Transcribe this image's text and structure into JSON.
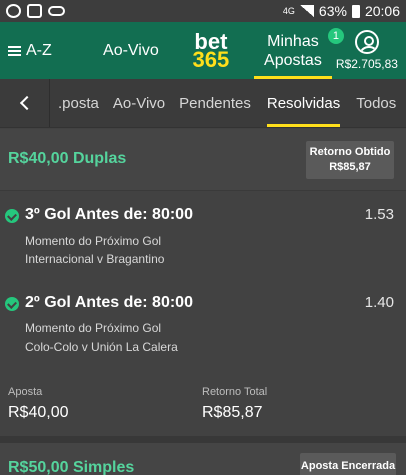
{
  "status_bar": {
    "network": "4G",
    "battery": "63%",
    "time": "20:06"
  },
  "header": {
    "menu_label": "A-Z",
    "live_label": "Ao-Vivo",
    "logo_top": "bet",
    "logo_bottom": "365",
    "my_bets_line1": "Minhas",
    "my_bets_line2": "Apostas",
    "my_bets_badge": "1",
    "balance": "R$2.705,83"
  },
  "tabs": [
    {
      "label": ".posta"
    },
    {
      "label": "Ao-Vivo"
    },
    {
      "label": "Pendentes"
    },
    {
      "label": "Resolvidas"
    },
    {
      "label": "Todos"
    }
  ],
  "bet": {
    "title": "R$40,00 Duplas",
    "return_label": "Retorno Obtido",
    "return_value": "R$85,87",
    "selections": [
      {
        "name": "3º Gol Antes de: 80:00",
        "odds": "1.53",
        "market": "Momento do Próximo Gol",
        "event": "Internacional v Bragantino"
      },
      {
        "name": "2º Gol Antes de: 80:00",
        "odds": "1.40",
        "market": "Momento do Próximo Gol",
        "event": "Colo-Colo v Unión La Calera"
      }
    ],
    "stake_label": "Aposta",
    "stake_value": "R$40,00",
    "total_return_label": "Retorno Total",
    "total_return_value": "R$85,87"
  },
  "next_bet": {
    "title": "R$50,00 Simples",
    "status": "Aposta Encerrada"
  },
  "colors": {
    "header_green": "#126e51",
    "accent_yellow": "#ffdf1b",
    "win_green": "#25c77d",
    "bet_title_green": "#55d49d",
    "background": "#424242"
  }
}
